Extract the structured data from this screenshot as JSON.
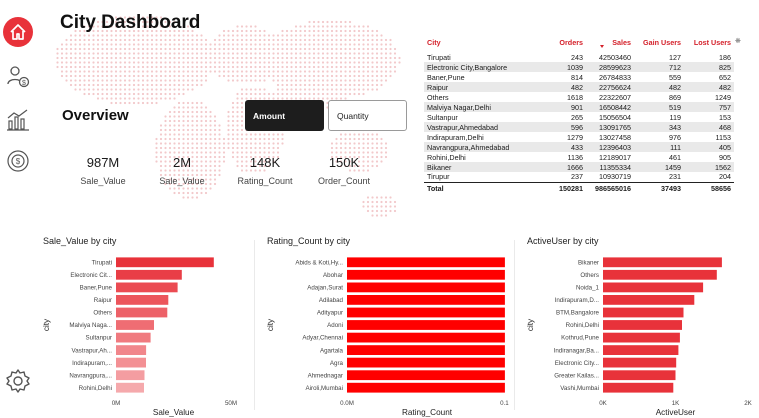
{
  "header": {
    "title": "City Dashboard",
    "overview": "Overview"
  },
  "toggle": {
    "amount": "Amount",
    "quantity": "Quantity",
    "selected": "Amount"
  },
  "sidebar": [
    "home-icon",
    "users-money-icon",
    "bar-chart-icon",
    "coin-refresh-icon",
    "settings-icon"
  ],
  "kpis": [
    {
      "value": "987M",
      "label": "Sale_Value"
    },
    {
      "value": "2M",
      "label": "Sale_Value"
    },
    {
      "value": "148K",
      "label": "Rating_Count"
    },
    {
      "value": "150K",
      "label": "Order_Count"
    }
  ],
  "table": {
    "columns": [
      "City",
      "Orders",
      "Sales",
      "Gain Users",
      "Lost Users"
    ],
    "rows": [
      [
        "Tirupati",
        "243",
        "42503460",
        "127",
        "186"
      ],
      [
        "Electronic City,Bangalore",
        "1039",
        "28599623",
        "712",
        "825"
      ],
      [
        "Baner,Pune",
        "814",
        "26784833",
        "559",
        "652"
      ],
      [
        "Raipur",
        "482",
        "22756624",
        "482",
        "482"
      ],
      [
        "Others",
        "1618",
        "22322607",
        "869",
        "1249"
      ],
      [
        "Malviya Nagar,Delhi",
        "901",
        "16508442",
        "519",
        "757"
      ],
      [
        "Sultanpur",
        "265",
        "15056504",
        "119",
        "153"
      ],
      [
        "Vastrapur,Ahmedabad",
        "596",
        "13091765",
        "343",
        "468"
      ],
      [
        "Indirapuram,Delhi",
        "1279",
        "13027458",
        "976",
        "1153"
      ],
      [
        "Navrangpura,Ahmedabad",
        "433",
        "12396403",
        "111",
        "405"
      ],
      [
        "Rohini,Delhi",
        "1136",
        "12189017",
        "461",
        "905"
      ],
      [
        "Bikaner",
        "1666",
        "11355334",
        "1459",
        "1562"
      ],
      [
        "Tirupur",
        "237",
        "10930719",
        "231",
        "204"
      ]
    ],
    "total": [
      "Total",
      "150281",
      "986565016",
      "37493",
      "58656"
    ]
  },
  "chart_data": [
    {
      "type": "bar",
      "title": "Sale_Value by city",
      "xlabel": "Sale_Value",
      "ylabel": "city",
      "categories": [
        "Tirupati",
        "Electronic Cit...",
        "Baner,Pune",
        "Raipur",
        "Others",
        "Malviya Naga...",
        "Sultanpur",
        "Vastrapur,Ah...",
        "Indirapuram,...",
        "Navrangpura,...",
        "Rohini,Delhi"
      ],
      "values": [
        42503460,
        28599623,
        26784833,
        22756624,
        22322607,
        16508442,
        15056504,
        13091765,
        13027458,
        12396403,
        12189017
      ],
      "xlim": [
        0,
        50000000
      ],
      "ticks": [
        "0M",
        "50M"
      ],
      "color": "#e8323a"
    },
    {
      "type": "bar",
      "title": "Rating_Count by city",
      "xlabel": "Rating_Count",
      "ylabel": "city",
      "categories": [
        "Abids & Koti,Hy...",
        "Abohar",
        "Adajan,Surat",
        "Adilabad",
        "Adityapur",
        "Adoni",
        "Adyar,Chennai",
        "Agartala",
        "Agra",
        "Ahmednagar",
        "Airoli,Mumbai"
      ],
      "values": [
        148000,
        148000,
        148000,
        148000,
        148000,
        148000,
        148000,
        148000,
        148000,
        148000,
        148000
      ],
      "xlim": [
        0,
        150000
      ],
      "ticks": [
        "0.0M",
        "0.1M"
      ],
      "color": "#ff0000"
    },
    {
      "type": "bar",
      "title": "ActiveUser by city",
      "xlabel": "ActiveUser",
      "ylabel": "city",
      "categories": [
        "Bikaner",
        "Others",
        "Noida_1",
        "Indirapuram,D...",
        "BTM,Bangalore",
        "Rohini,Delhi",
        "Kothrud,Pune",
        "Indiranagar,Ba...",
        "Electronic City...",
        "Greater Kailas...",
        "Vashi,Mumbai"
      ],
      "values": [
        1640,
        1570,
        1380,
        1260,
        1110,
        1090,
        1060,
        1040,
        1010,
        1000,
        970
      ],
      "xlim": [
        0,
        2000
      ],
      "ticks": [
        "0K",
        "1K",
        "2K"
      ],
      "color": "#e8323a"
    }
  ]
}
